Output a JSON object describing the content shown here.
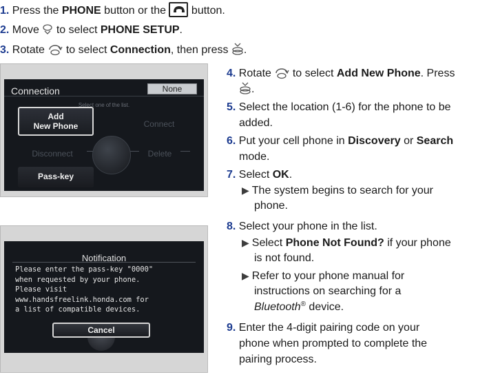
{
  "steps_top": [
    {
      "num": "1.",
      "pre": "Press the ",
      "b1": "PHONE",
      "mid": " button or the ",
      "icon": "phone-button-icon",
      "post": " button."
    },
    {
      "num": "2.",
      "pre": "Move ",
      "icon": "joystick-down-icon",
      "mid": " to select ",
      "b1": "PHONE SETUP",
      "post": "."
    },
    {
      "num": "3.",
      "pre": "Rotate ",
      "icon": "rotate-knob-icon",
      "mid": " to select ",
      "b1": "Connection",
      "post": ", then press ",
      "icon2": "press-knob-icon",
      "post2": "."
    }
  ],
  "connection_screen": {
    "title": "Connection",
    "status": "None",
    "hint": "Select one of the list.",
    "options": {
      "add_new_phone_1": "Add",
      "add_new_phone_2": "New Phone",
      "connect": "Connect",
      "disconnect": "Disconnect",
      "delete": "Delete",
      "pass_key": "Pass-key"
    }
  },
  "notification_screen": {
    "title": "Notification",
    "body": "Please enter the pass-key \"0000\"\nwhen requested by your phone.\nPlease visit\nwww.handsfreelink.honda.com for\na list of compatible devices.",
    "cancel": "Cancel"
  },
  "steps_right": {
    "s4": {
      "num": "4.",
      "pre": "Rotate ",
      "mid": " to select ",
      "b1": "Add New Phone",
      "post": ". Press",
      "post2": "."
    },
    "s5": {
      "num": "5.",
      "line1": "Select the location (1-6) for the phone to be",
      "line2": "added."
    },
    "s6": {
      "num": "6.",
      "pre": "Put your cell phone in ",
      "b1": "Discovery",
      "mid": " or ",
      "b2": "Search",
      "line2": "mode."
    },
    "s7": {
      "num": "7.",
      "pre": "Select ",
      "b1": "OK",
      "post": ".",
      "sub1": "The system begins to search for your",
      "sub2": "phone."
    },
    "s8": {
      "num": "8.",
      "text": "Select your phone in the list.",
      "sub_a_pre": "Select ",
      "sub_a_b": "Phone Not Found?",
      "sub_a_post": " if your phone",
      "sub_a_2": "is not found.",
      "sub_b_1": "Refer to your phone manual for",
      "sub_b_2": "instructions on searching for a",
      "sub_b_3_i": "Bluetooth",
      "sub_b_3_sup": "®",
      "sub_b_3_post": " device."
    },
    "s9": {
      "num": "9.",
      "line1": "Enter the 4-digit pairing code on your",
      "line2": "phone when prompted to complete the",
      "line3": "pairing process."
    }
  },
  "arrow_glyph": "▶"
}
